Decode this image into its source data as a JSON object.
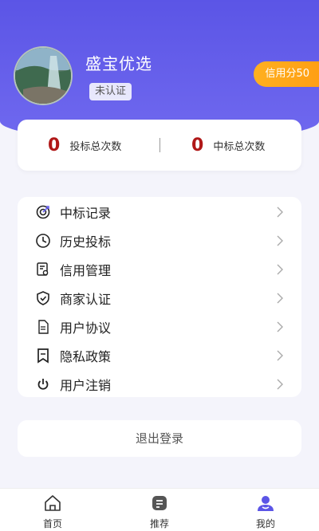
{
  "profile": {
    "name": "盛宝优选",
    "cert_status": "未认证",
    "credit_label": "信用分50"
  },
  "stats": {
    "bid_count": "0",
    "bid_label": "投标总次数",
    "win_count": "0",
    "win_label": "中标总次数"
  },
  "menu": [
    {
      "label": "中标记录",
      "icon": "target-icon"
    },
    {
      "label": "历史投标",
      "icon": "clock-icon"
    },
    {
      "label": "信用管理",
      "icon": "certificate-icon"
    },
    {
      "label": "商家认证",
      "icon": "shield-check-icon"
    },
    {
      "label": "用户协议",
      "icon": "document-icon"
    },
    {
      "label": "隐私政策",
      "icon": "bookmark-icon"
    },
    {
      "label": "用户注销",
      "icon": "power-icon"
    }
  ],
  "logout_label": "退出登录",
  "tabs": [
    {
      "label": "首页",
      "icon": "home-icon"
    },
    {
      "label": "推荐",
      "icon": "note-icon"
    },
    {
      "label": "我的",
      "icon": "user-icon",
      "active": true
    }
  ],
  "colors": {
    "header": "#5b55e6",
    "credit_badge": "#ffa31a",
    "stat_number": "#b01818",
    "tab_active": "#5b55e6"
  }
}
